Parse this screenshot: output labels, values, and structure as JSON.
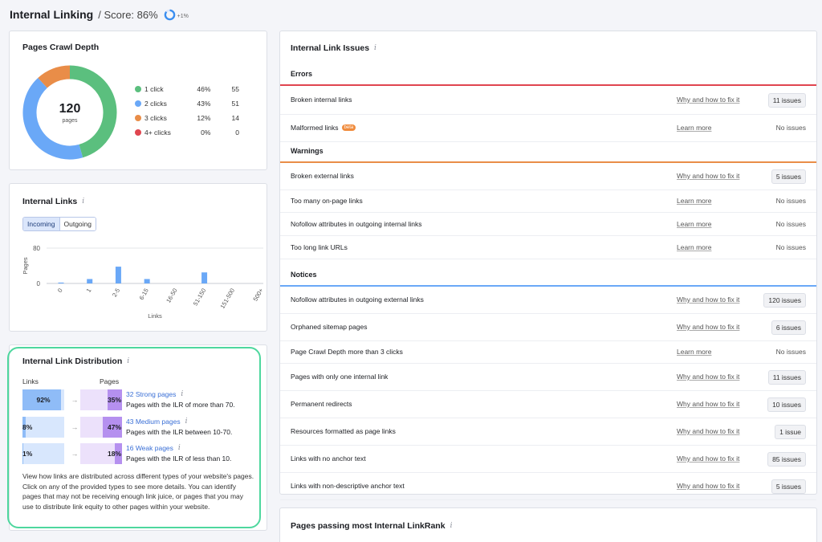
{
  "header": {
    "title": "Internal Linking",
    "score": "/ Score: 86%",
    "score_value": 0.86,
    "score_delta": "+1%"
  },
  "crawl_depth": {
    "title": "Pages Crawl Depth",
    "total": "120",
    "total_unit": "pages",
    "items": [
      {
        "label": "1 click",
        "pct": "46%",
        "count": "55",
        "value": 46,
        "color": "#5bbf7e"
      },
      {
        "label": "2 clicks",
        "pct": "43%",
        "count": "51",
        "value": 43,
        "color": "#6aa8f7"
      },
      {
        "label": "3 clicks",
        "pct": "12%",
        "count": "14",
        "value": 12,
        "color": "#e98d48"
      },
      {
        "label": "4+ clicks",
        "pct": "0%",
        "count": "0",
        "value": 0,
        "color": "#e0454f"
      }
    ]
  },
  "internal_links": {
    "title": "Internal Links",
    "tabs": [
      "Incoming",
      "Outgoing"
    ],
    "active_tab": "Incoming"
  },
  "chart_data": {
    "type": "bar",
    "categories": [
      "0",
      "1",
      "2-5",
      "6-15",
      "16-50",
      "51-150",
      "151-500",
      "500+"
    ],
    "values": [
      2,
      10,
      38,
      10,
      0,
      25,
      0,
      0
    ],
    "xlabel": "Links",
    "ylabel": "Pages",
    "ylim": [
      0,
      80
    ],
    "yticks": [
      "0",
      "80"
    ],
    "grid": true,
    "bar_color": "#6aa8f7"
  },
  "distribution": {
    "title": "Internal Link Distribution",
    "col_links": "Links",
    "col_pages": "Pages",
    "rows": [
      {
        "links_pct": "92%",
        "links_value": 92,
        "pages_pct": "35%",
        "pages_value": 35,
        "link": "32 Strong pages",
        "desc": "Pages with the ILR of more than 70."
      },
      {
        "links_pct": "8%",
        "links_value": 8,
        "pages_pct": "47%",
        "pages_value": 47,
        "link": "43 Medium pages",
        "desc": "Pages with the ILR between 10-70."
      },
      {
        "links_pct": "1%",
        "links_value": 1,
        "pages_pct": "18%",
        "pages_value": 18,
        "link": "16 Weak pages",
        "desc": "Pages with the ILR of less than 10."
      }
    ],
    "text": "View how links are distributed across different types of your website's pages. Click on any of the provided types to see more details. You can identify pages that may not be receiving enough link juice, or pages that you may use to distribute link equity to other pages within your website."
  },
  "issues": {
    "title": "Internal Link Issues",
    "errors_label": "Errors",
    "warnings_label": "Warnings",
    "notices_label": "Notices",
    "colors": {
      "errors": "#e0454f",
      "warnings": "#e98d48",
      "notices": "#6aa8f7"
    },
    "errors": [
      {
        "name": "Broken internal links",
        "link": "Why and how to fix it",
        "badge": "11 issues"
      },
      {
        "name": "Malformed links",
        "beta": "beta",
        "link": "Learn more",
        "none": "No issues"
      }
    ],
    "warnings": [
      {
        "name": "Broken external links",
        "link": "Why and how to fix it",
        "badge": "5 issues"
      },
      {
        "name": "Too many on-page links",
        "link": "Learn more",
        "none": "No issues"
      },
      {
        "name": "Nofollow attributes in outgoing internal links",
        "link": "Learn more",
        "none": "No issues"
      },
      {
        "name": "Too long link URLs",
        "link": "Learn more",
        "none": "No issues"
      }
    ],
    "notices": [
      {
        "name": "Nofollow attributes in outgoing external links",
        "link": "Why and how to fix it",
        "badge": "120 issues"
      },
      {
        "name": "Orphaned sitemap pages",
        "link": "Why and how to fix it",
        "badge": "6 issues"
      },
      {
        "name": "Page Crawl Depth more than 3 clicks",
        "link": "Learn more",
        "none": "No issues"
      },
      {
        "name": "Pages with only one internal link",
        "link": "Why and how to fix it",
        "badge": "11 issues"
      },
      {
        "name": "Permanent redirects",
        "link": "Why and how to fix it",
        "badge": "10 issues"
      },
      {
        "name": "Resources formatted as page links",
        "link": "Why and how to fix it",
        "badge": "1 issue"
      },
      {
        "name": "Links with no anchor text",
        "link": "Why and how to fix it",
        "badge": "85 issues"
      },
      {
        "name": "Links with non-descriptive anchor text",
        "link": "Why and how to fix it",
        "badge": "5 issues"
      }
    ]
  },
  "passing": {
    "title": "Pages passing most Internal LinkRank"
  }
}
